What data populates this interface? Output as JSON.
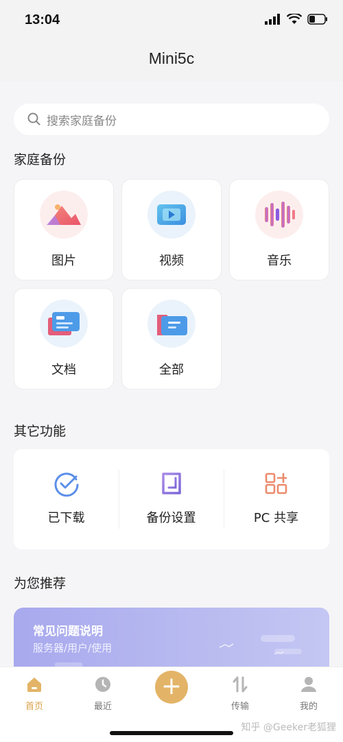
{
  "status": {
    "time": "13:04"
  },
  "nav": {
    "title": "Mini5c"
  },
  "search": {
    "placeholder": "搜索家庭备份"
  },
  "family_backup": {
    "title": "家庭备份",
    "tiles": [
      {
        "label": "图片",
        "icon": "mountain-image-icon"
      },
      {
        "label": "视频",
        "icon": "video-play-icon"
      },
      {
        "label": "音乐",
        "icon": "music-wave-icon"
      },
      {
        "label": "文档",
        "icon": "document-card-icon"
      },
      {
        "label": "全部",
        "icon": "folder-icon"
      }
    ]
  },
  "other_functions": {
    "title": "其它功能",
    "items": [
      {
        "label": "已下载",
        "icon": "downloaded-check-icon"
      },
      {
        "label": "备份设置",
        "icon": "backup-settings-icon"
      },
      {
        "label": "PC 共享",
        "icon": "pc-share-icon"
      }
    ]
  },
  "recommend": {
    "title": "为您推荐",
    "banner": {
      "title": "常见问题说明",
      "subtitle": "服务器/用户/使用"
    }
  },
  "tabs": [
    {
      "label": "首页",
      "icon": "home-icon",
      "active": true
    },
    {
      "label": "最近",
      "icon": "clock-icon"
    },
    {
      "label": "传输",
      "icon": "transfer-icon"
    },
    {
      "label": "我的",
      "icon": "user-icon"
    }
  ],
  "add_button": {
    "label": "+"
  },
  "watermark": {
    "text": "知乎 @Geeker老狐狸"
  },
  "colors": {
    "accent": "#e3b467",
    "background": "#f5f5f7"
  }
}
